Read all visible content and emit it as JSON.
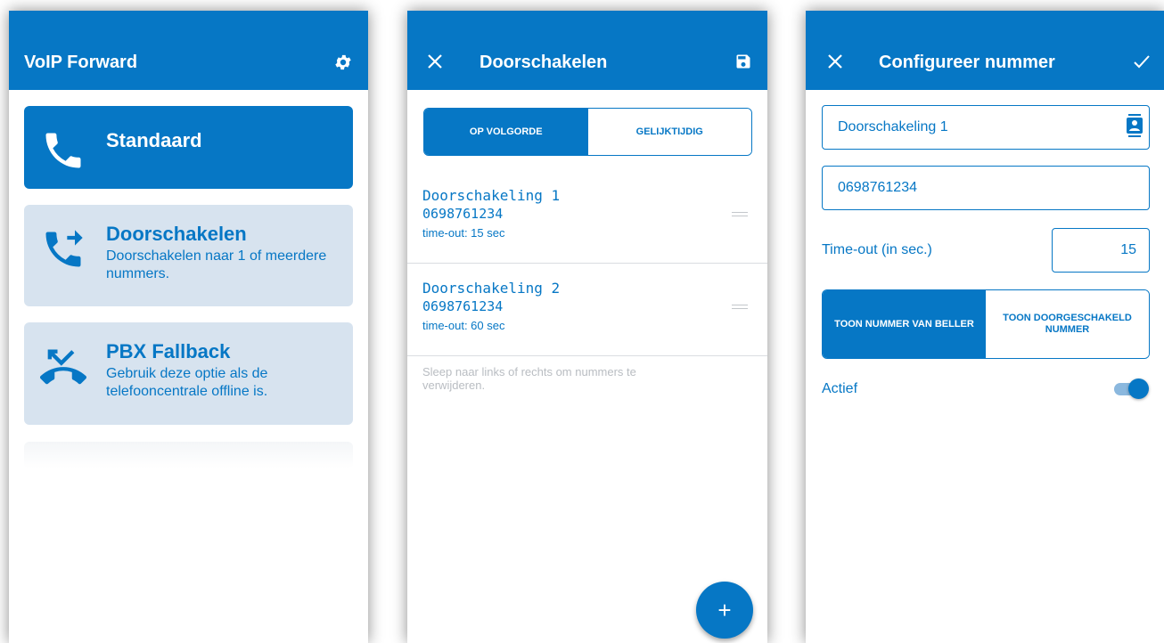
{
  "colors": {
    "primary": "#0677c5",
    "card_light": "#d7e3ef",
    "divider": "#dadde1",
    "hint": "#b9bdc2"
  },
  "screen1": {
    "title": "VoIP Forward",
    "settings_icon": "gear-icon",
    "cards": [
      {
        "icon": "phone-icon",
        "title": "Standaard",
        "description": ""
      },
      {
        "icon": "phone-forward-icon",
        "title": "Doorschakelen",
        "description": "Doorschakelen naar 1 of meerdere nummers."
      },
      {
        "icon": "phone-missed-icon",
        "title": "PBX Fallback",
        "description": "Gebruik deze optie als de telefooncentrale offline is."
      }
    ]
  },
  "screen2": {
    "title": "Doorschakelen",
    "close_icon": "close-icon",
    "save_icon": "save-icon",
    "segments": [
      {
        "label": "OP VOLGORDE",
        "active": true
      },
      {
        "label": "GELIJKTIJDIG",
        "active": false
      }
    ],
    "items": [
      {
        "name": "Doorschakeling 1",
        "number": "0698761234",
        "timeout": "time-out: 15 sec"
      },
      {
        "name": "Doorschakeling 2",
        "number": "0698761234",
        "timeout": "time-out: 60 sec"
      }
    ],
    "hint": "Sleep naar links of rechts om nummers te verwijderen.",
    "fab_label": "+"
  },
  "screen3": {
    "title": "Configureer nummer",
    "close_icon": "close-icon",
    "confirm_icon": "check-icon",
    "name_value": "Doorschakeling 1",
    "number_value": "0698761234",
    "timeout_label": "Time-out (in sec.)",
    "timeout_value": "15",
    "segments": [
      {
        "label": "TOON NUMMER VAN BELLER",
        "active": true
      },
      {
        "label": "TOON DOORGESCHAKELD NUMMER",
        "active": false
      }
    ],
    "active_label": "Actief",
    "active_on": true
  }
}
